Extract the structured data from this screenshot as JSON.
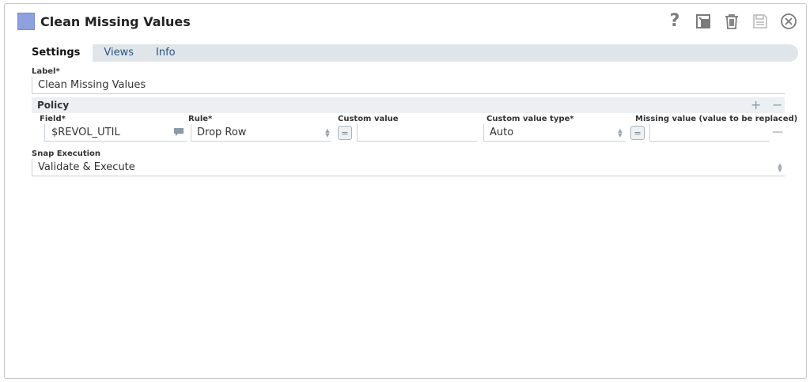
{
  "window": {
    "title": "Clean Missing Values",
    "swatch_color": "#8da0e0"
  },
  "toolbar": {
    "help_icon": "?",
    "icons": [
      "help-icon",
      "export-icon",
      "delete-icon",
      "save-icon",
      "close-icon"
    ]
  },
  "tabs": [
    {
      "label": "Settings",
      "active": true
    },
    {
      "label": "Views",
      "active": false
    },
    {
      "label": "Info",
      "active": false
    }
  ],
  "label_field": {
    "label": "Label*",
    "value": "Clean Missing Values"
  },
  "policy": {
    "title": "Policy",
    "add": "+",
    "remove": "−",
    "columns": {
      "field": "Field*",
      "rule": "Rule*",
      "custom_value": "Custom value",
      "custom_value_type": "Custom value type*",
      "missing_value": "Missing value (value to be replaced)"
    },
    "row": {
      "field": "$REVOL_UTIL",
      "rule": "Drop Row",
      "custom_value": "",
      "custom_value_type": "Auto",
      "missing_value": "",
      "eq": "=",
      "row_remove": "—"
    }
  },
  "snap_execution": {
    "label": "Snap Execution",
    "value": "Validate & Execute"
  }
}
